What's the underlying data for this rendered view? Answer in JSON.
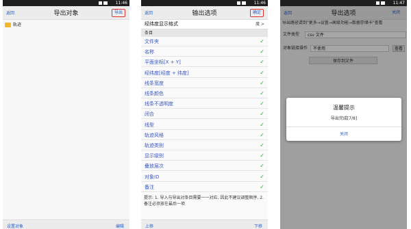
{
  "status_time_1": "11:46",
  "status_time_2": "11:46",
  "status_time_3": "11:47",
  "panel1": {
    "back": "返回",
    "title": "导出对象",
    "action": "导出",
    "folder": "轨迹",
    "bottom_left": "设置对象",
    "bottom_right": "编辑"
  },
  "panel2": {
    "back": "返回",
    "title": "输出选项",
    "action": "确定",
    "format_label": "经纬度显示格式",
    "format_value": "度 >",
    "section": "条目",
    "items": [
      "文件夹",
      "名称",
      "平面坐标[X + Y]",
      "经纬度[经度 + 纬度]",
      "线条宽度",
      "线条颜色",
      "线条不透明度",
      "闭合",
      "线型",
      "轨迹风格",
      "轨迹类别",
      "显示级别",
      "叠放层次",
      "对象ID",
      "备注"
    ],
    "check": "✓",
    "note": "提示: 1. 导入与导出对条目需要一一对应, 因此不建议调整顺序, 2. 备注必须放在最后一项",
    "bottom_left": "上移",
    "bottom_right": "下移"
  },
  "panel3": {
    "back": "返回",
    "title": "导出选项",
    "action": "关闭",
    "path_text": "导出路径请到\"更多→设置→高级功能→数据存储卡\"查看",
    "file_type_label": "文件类型",
    "file_type_value": "csv 文件",
    "link_label": "对象链接操作",
    "link_value": "不使用",
    "view_label": "查看",
    "save_button": "保存到文件",
    "dialog_title": "温馨提示",
    "dialog_msg": "导出完成[7/8]",
    "dialog_button": "关闭"
  }
}
